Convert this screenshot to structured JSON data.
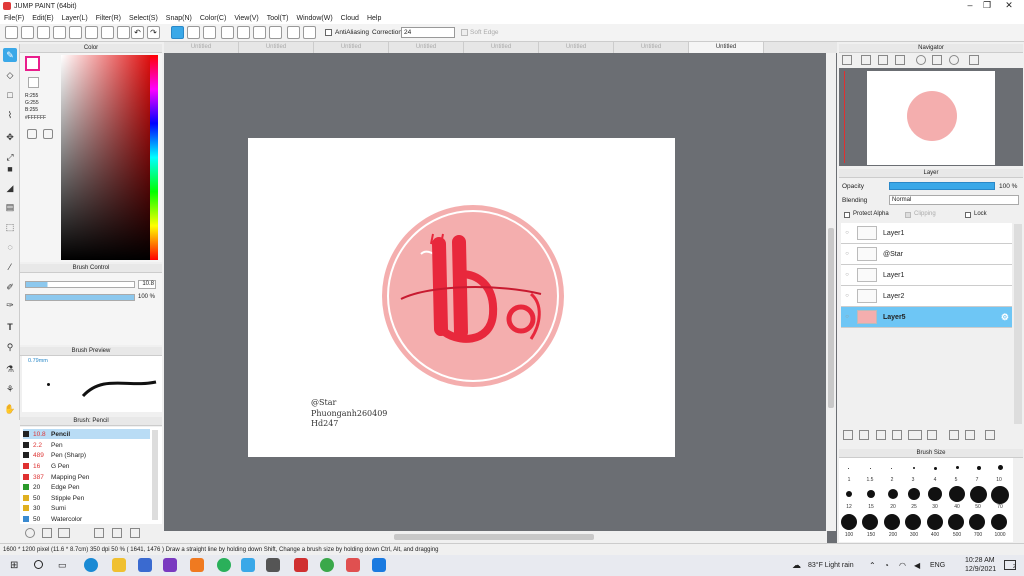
{
  "window": {
    "title": "JUMP PAINT (64bit)"
  },
  "menu": [
    "File(F)",
    "Edit(E)",
    "Layer(L)",
    "Filter(R)",
    "Select(S)",
    "Snap(N)",
    "Color(C)",
    "View(V)",
    "Tool(T)",
    "Window(W)",
    "Cloud",
    "Help"
  ],
  "toolbar": {
    "antialias_label": "AntiAliasing",
    "correction_label": "Correction",
    "correction_value": "24",
    "soft_edge_label": "Soft Edge"
  },
  "tabs": [
    "Untitled",
    "Untitled",
    "Untitled",
    "Untitled",
    "Untitled",
    "Untitled",
    "Untitled",
    "Untitled"
  ],
  "color_panel": {
    "title": "Color",
    "r": "R:255",
    "g": "G:255",
    "b": "B:255",
    "hex": "#FFFFFF"
  },
  "brush_control": {
    "title": "Brush Control",
    "size": "10.8",
    "opacity": "100 %"
  },
  "brush_preview": {
    "title": "Brush Preview",
    "size_label": "0.79mm"
  },
  "brush_list": {
    "title": "Brush: Pencil",
    "items": [
      {
        "size": "10.8",
        "name": "Pencil",
        "color": "#222222"
      },
      {
        "size": "2.2",
        "name": "Pen",
        "color": "#222222"
      },
      {
        "size": "489",
        "name": "Pen (Sharp)",
        "color": "#222222"
      },
      {
        "size": "16",
        "name": "G Pen",
        "color": "#e03030"
      },
      {
        "size": "387",
        "name": "Mapping Pen",
        "color": "#e03030"
      },
      {
        "size": "20",
        "name": "Edge Pen",
        "color": "#2a9a2a"
      },
      {
        "size": "50",
        "name": "Stipple Pen",
        "color": "#e0b020"
      },
      {
        "size": "30",
        "name": "Sumi",
        "color": "#e0b020"
      },
      {
        "size": "50",
        "name": "Watercolor",
        "color": "#3a8ad0"
      }
    ]
  },
  "canvas_text": [
    "@Star",
    "Phuonganh260409",
    "Hd247"
  ],
  "navigator": {
    "title": "Navigator"
  },
  "layer_panel": {
    "title": "Layer",
    "opacity_label": "Opacity",
    "opacity_value": "100 %",
    "blending_label": "Blending",
    "blending_value": "Normal",
    "protect_alpha": "Protect Alpha",
    "clipping": "Clipping",
    "lock": "Lock",
    "layers": [
      "Layer1",
      "@Star",
      "Layer1",
      "Layer2",
      "Layer5"
    ]
  },
  "brush_size": {
    "title": "Brush Size",
    "rows": [
      [
        "",
        "",
        "1",
        "1.5",
        "2",
        "3",
        "4",
        "5",
        "7",
        "10"
      ],
      [
        "12",
        "15",
        "20",
        "25",
        "30",
        "40",
        "50",
        "70"
      ],
      [
        "100",
        "150",
        "200",
        "300",
        "400",
        "500",
        "700",
        "1000"
      ]
    ]
  },
  "status": {
    "text": "1600 * 1200 pixel   (11.6 * 8.7cm)   350 dpi   50 %   ( 1641, 1476 )   Draw a straight line by holding down Shift, Change a brush size by holding down Ctrl, Alt, and dragging"
  },
  "taskbar": {
    "weather": "83°F  Light rain",
    "lang": "ENG",
    "time": "10:28 AM",
    "date": "12/9/2021",
    "notif": "2"
  },
  "colors": {
    "accent": "#3aa8e8",
    "canvas_bg": "#6b6e73",
    "seal": "#f4aeae",
    "seal_ink": "#e8283c"
  }
}
